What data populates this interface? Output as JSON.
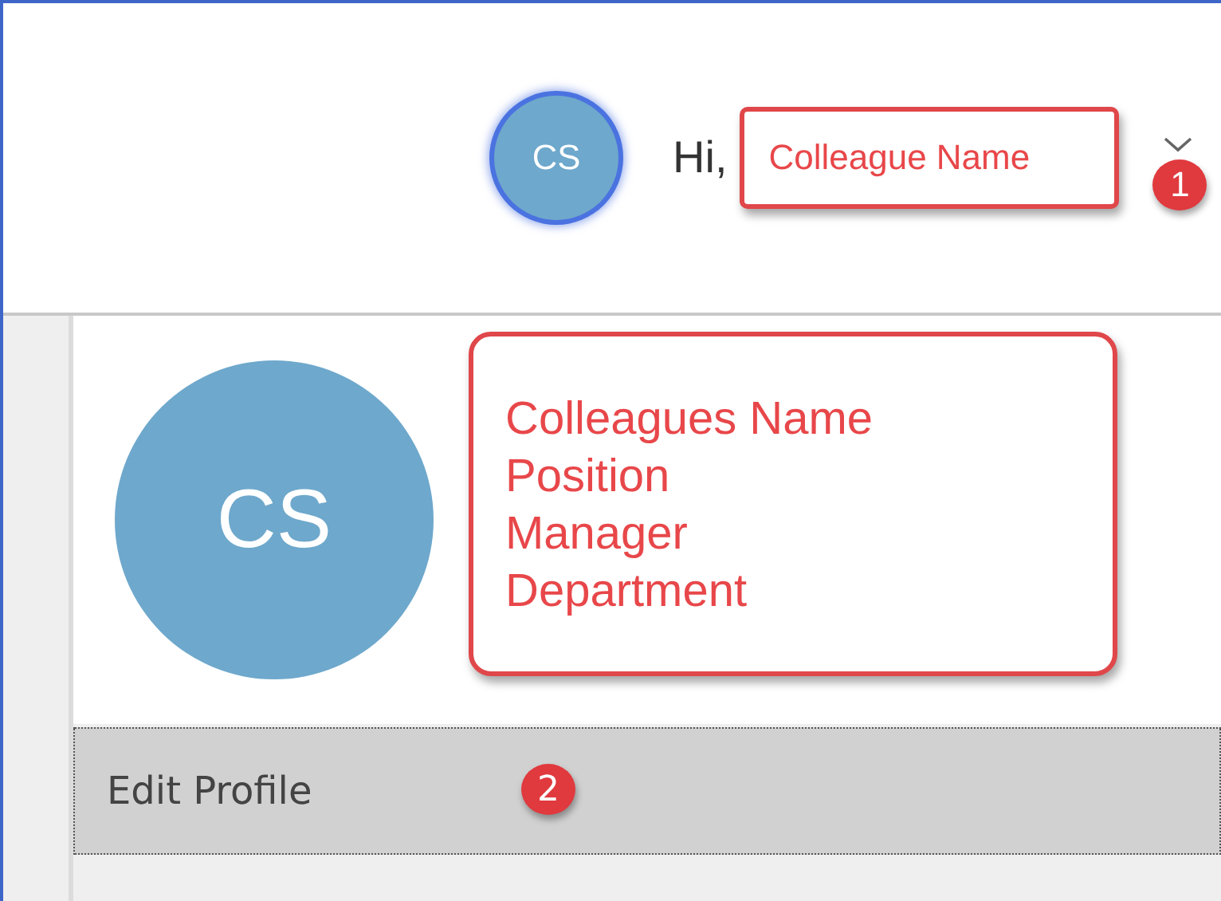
{
  "header": {
    "avatar_initials": "CS",
    "greeting": "Hi,",
    "user_name": "Colleague Name",
    "name_badge": "1"
  },
  "profile": {
    "avatar_initials": "CS",
    "details": [
      "Colleagues Name",
      "Position",
      "Manager",
      "Department"
    ]
  },
  "menu": [
    {
      "label": "Edit Profile",
      "selected": true,
      "badge": "2"
    }
  ]
}
